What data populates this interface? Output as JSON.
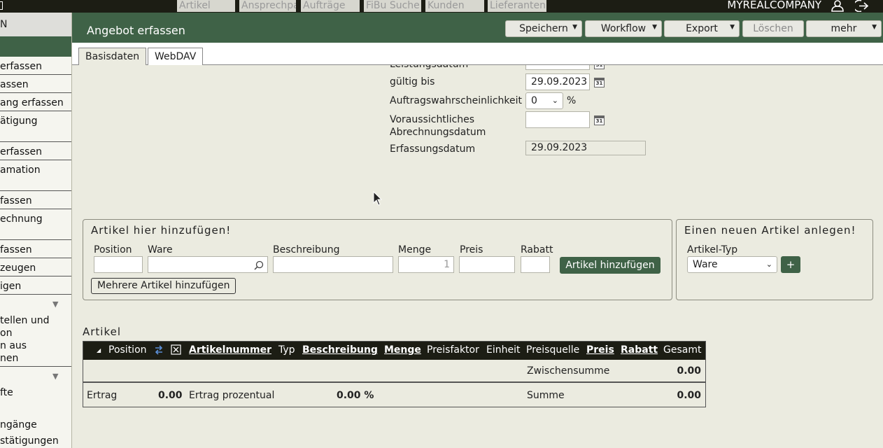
{
  "topbar": {
    "search_fields": [
      "Artikel",
      "Ansprechpartner",
      "Aufträge",
      "FiBu Suche",
      "Kunden",
      "Lieferanten"
    ],
    "company": "MYREALCOMPANY",
    "icons": [
      "user-icon",
      "logout-icon"
    ]
  },
  "sidebar": {
    "head": "N",
    "items": [
      " erfassen",
      "assen",
      "ang erfassen",
      "ätigung",
      "erfassen",
      "amation",
      "fassen",
      "echnung",
      "fassen",
      "zeugen",
      "igen",
      "tellen und",
      "on",
      "n aus",
      "nen",
      "fte",
      "ngänge",
      "stätigungen"
    ]
  },
  "header": {
    "title": "Angebot erfassen",
    "buttons": {
      "save": "Speichern",
      "workflow": "Workflow",
      "export": "Export",
      "delete": "Löschen",
      "more": "mehr"
    }
  },
  "tabs": [
    "Basisdaten",
    "WebDAV"
  ],
  "form": {
    "leistungsdatum_label": "Leistungsdatum",
    "gueltig_bis_label": "gültig bis",
    "gueltig_bis_value": "29.09.2023",
    "wahrscheinlichkeit_label": "Auftragswahrscheinlichkeit",
    "wahrscheinlichkeit_value": "0",
    "percent": "%",
    "abrechnung_label_1": "Voraussichtliches",
    "abrechnung_label_2": "Abrechnungsdatum",
    "abrechnung_value": "",
    "erfassungsdatum_label": "Erfassungsdatum",
    "erfassungsdatum_value": "29.09.2023",
    "calendar_glyph": "31"
  },
  "add_article": {
    "legend": "Artikel hier hinzufügen!",
    "columns": [
      "Position",
      "Ware",
      "Beschreibung",
      "Menge",
      "Preis",
      "Rabatt"
    ],
    "menge_placeholder": "1",
    "add_button": "Artikel hinzufügen",
    "multi_button": "Mehrere Artikel hinzufügen"
  },
  "new_article": {
    "legend": "Einen neuen Artikel anlegen!",
    "type_label": "Artikel-Typ",
    "type_value": "Ware",
    "plus_button": "+"
  },
  "articles": {
    "heading": "Artikel",
    "columns": {
      "position": "Position",
      "artikelnummer": "Artikelnummer",
      "typ": "Typ",
      "beschreibung": "Beschreibung",
      "menge": "Menge",
      "preisfaktor": "Preisfaktor",
      "einheit": "Einheit",
      "preisquelle": "Preisquelle",
      "preis": "Preis",
      "rabatt": "Rabatt",
      "gesamt": "Gesamt"
    },
    "zwischensumme_label": "Zwischensumme",
    "zwischensumme_value": "0.00",
    "ertrag_label": "Ertrag",
    "ertrag_value": "0.00",
    "ertrag_prozentual_label": "Ertrag prozentual",
    "ertrag_prozentual_value": "0.00 %",
    "summe_label": "Summe",
    "summe_value": "0.00"
  }
}
